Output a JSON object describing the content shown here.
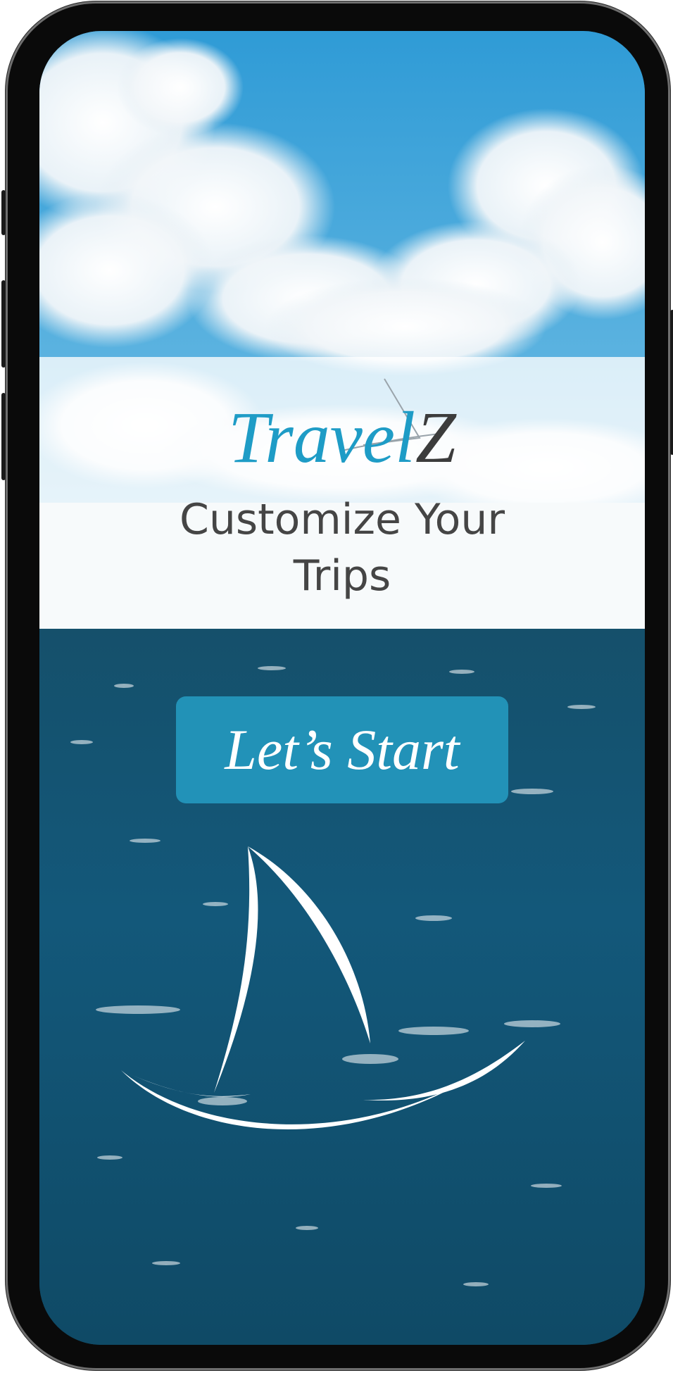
{
  "app": {
    "logo_part1": "Travel",
    "logo_part2": "Z",
    "tagline_line1": "Customize Your",
    "tagline_line2": "Trips",
    "start_button_label": "Let’s Start"
  },
  "icons": {
    "logo_mark": "sailboat-outline-icon",
    "hero_mark": "sailboat-outline-icon"
  },
  "colors": {
    "brand_blue": "#1e9cc6",
    "brand_dark": "#3c3c3c",
    "button_fill": "#28aad2",
    "sky": "#4aa9dc",
    "sea": "#145a78"
  }
}
